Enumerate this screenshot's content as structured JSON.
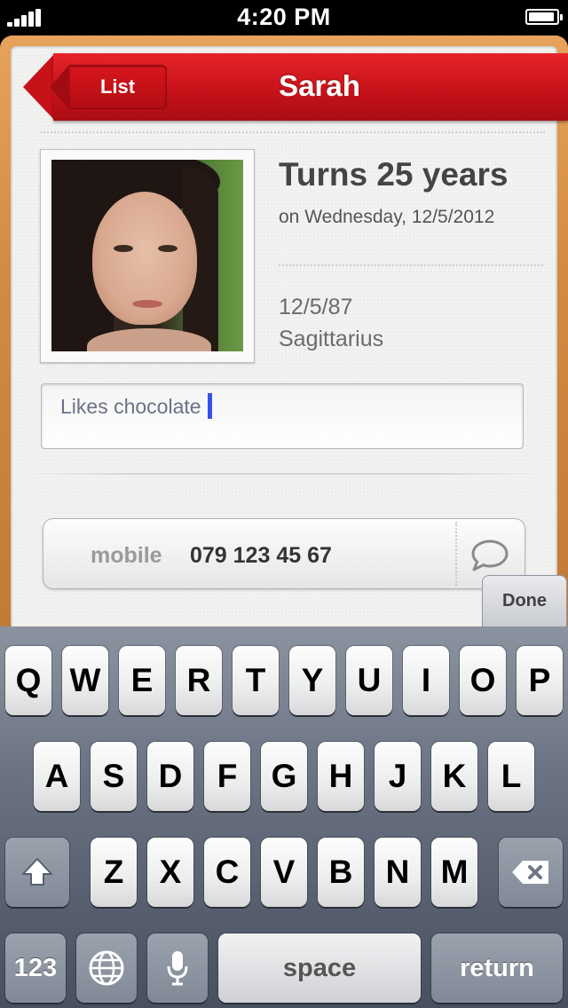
{
  "status_bar": {
    "time": "4:20 PM"
  },
  "nav": {
    "back_label": "List",
    "title": "Sarah"
  },
  "profile": {
    "age_title": "Turns 25 years",
    "age_subtitle": "on Wednesday, 12/5/2012",
    "birth_date": "12/5/87",
    "zodiac": "Sagittarius"
  },
  "note": {
    "text": "Likes chocolate"
  },
  "phone": {
    "label": "mobile",
    "number": "079 123 45 67"
  },
  "keyboard": {
    "done_label": "Done",
    "row1": [
      "Q",
      "W",
      "E",
      "R",
      "T",
      "Y",
      "U",
      "I",
      "O",
      "P"
    ],
    "row2": [
      "A",
      "S",
      "D",
      "F",
      "G",
      "H",
      "J",
      "K",
      "L"
    ],
    "row3": [
      "Z",
      "X",
      "C",
      "V",
      "B",
      "N",
      "M"
    ],
    "num_label": "123",
    "space_label": "space",
    "return_label": "return"
  },
  "colors": {
    "banner_red": "#c8121a",
    "caret": "#3553e6"
  },
  "icons": [
    "signal-icon",
    "battery-icon",
    "photo",
    "message-icon",
    "shift-icon",
    "delete-icon",
    "globe-icon",
    "microphone-icon"
  ]
}
